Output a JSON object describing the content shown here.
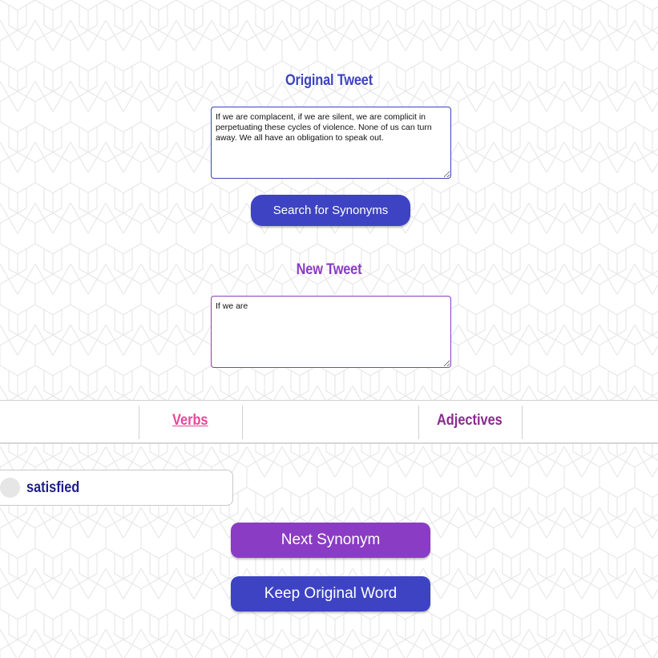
{
  "original_tweet": {
    "heading": "Original Tweet",
    "text": "If we are complacent, if we are silent, we are complicit in perpetuating these cycles of violence. None of us can turn away. We all have an obligation to speak out."
  },
  "search_button": {
    "label": "Search for Synonyms"
  },
  "new_tweet": {
    "heading": "New Tweet",
    "text": "If we are"
  },
  "tabs": [
    {
      "label": "Verbs",
      "active": true
    },
    {
      "label": "Adjectives",
      "active": false
    }
  ],
  "synonym_option": {
    "label": "satisfied",
    "selected": false
  },
  "next_button": {
    "label": "Next Synonym"
  },
  "keep_button": {
    "label": "Keep Original Word"
  },
  "colors": {
    "primary_blue": "#3d43c2",
    "primary_purple": "#8a3cc4",
    "tab_active": "#e8469a",
    "tab_inactive": "#8a2a8e",
    "synonym_text": "#1f1f8a"
  }
}
